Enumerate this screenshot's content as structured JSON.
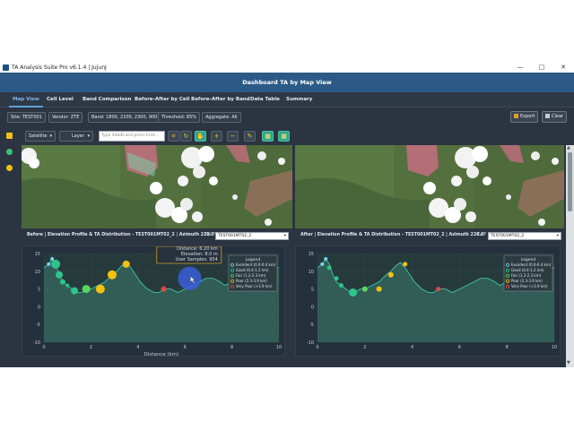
{
  "window": {
    "title": "TA Analysis Suite Pro v6.1.4 | JujunJ"
  },
  "banner": {
    "title": "Dashboard TA by Map View"
  },
  "tabs": [
    "Map View",
    "Cell Level",
    "Band Comparison",
    "Before-After by Cell",
    "Before-After by Band",
    "Data Table",
    "Summary"
  ],
  "filters": {
    "site": "Site: TEST001",
    "vendor": "Vendor: ZTE",
    "band": "Band: 1800, 2100, 2300, 900",
    "threshold": "Threshold: 85%",
    "aggregate": "Aggregate: All"
  },
  "actions": {
    "export": "Export",
    "clear": "Clear"
  },
  "toolbar": {
    "basemap": "Satellite",
    "layer": "Layer",
    "search_placeholder": "Type SiteID and press Ente..."
  },
  "before": {
    "title": "Before | Elevation Profile & TA Distribution - TEST001MT02_2 | Azimuth 220.0°",
    "cell_label": "Cell",
    "cell_value": "TEST001MT02_2"
  },
  "after": {
    "title": "After | Elevation Profile & TA Distribution - TEST001MT02_2 | Azimuth 220.0°",
    "cell_label": "Cell",
    "cell_value": "TEST001MT02_2"
  },
  "tooltip": {
    "line1": "Distance: 6.20 km",
    "line2": "Elevation: 8.0 m",
    "line3": "User Samples: 954"
  },
  "legend": {
    "title": "Legend",
    "items": [
      {
        "label": "Excellent (0.0-0.4 km)",
        "color": "#7ad3e8"
      },
      {
        "label": "Good (0.4-1.2 km)",
        "color": "#2ec48a"
      },
      {
        "label": "Fair (1.2-2.3 km)",
        "color": "#5ad65a"
      },
      {
        "label": "Poor (2.3-3.9 km)",
        "color": "#f2c20e"
      },
      {
        "label": "Very Poor (>3.9 km)",
        "color": "#e04848"
      }
    ]
  },
  "chart_data": [
    {
      "type": "line",
      "title": "",
      "xlabel": "Distance (km)",
      "ylabel": "",
      "xlim": [
        0,
        10
      ],
      "ylim": [
        -10,
        15
      ],
      "xticks": [
        0,
        2,
        4,
        6,
        8,
        10
      ],
      "yticks": [
        -10,
        -5,
        0,
        5,
        10,
        15
      ],
      "grid": true,
      "legend_position": "top-right",
      "profile": {
        "x": [
          0,
          0.2,
          0.35,
          0.5,
          0.65,
          0.8,
          1.0,
          1.2,
          1.4,
          1.6,
          1.8,
          2.0,
          2.3,
          2.6,
          2.9,
          3.1,
          3.3,
          3.5,
          3.7,
          3.9,
          4.1,
          4.4,
          4.7,
          4.9,
          5.1,
          5.4,
          5.7,
          6.0,
          6.3,
          6.6,
          6.9,
          7.2,
          7.5,
          7.7,
          8.0,
          8.3,
          8.6,
          9.0,
          9.3,
          9.6,
          10.0
        ],
        "y": [
          11,
          12,
          13.5,
          12,
          9,
          7,
          6,
          5,
          4,
          4,
          5,
          5,
          6,
          7,
          9,
          10,
          11.5,
          12.5,
          11,
          9,
          7,
          5,
          4,
          4,
          5,
          5,
          4,
          5,
          6,
          7,
          8,
          8,
          7,
          6,
          7,
          8,
          9,
          10,
          10,
          11,
          11
        ]
      },
      "samples": [
        {
          "x": 0.2,
          "y": 12,
          "size": 2,
          "color": "#7ad3e8"
        },
        {
          "x": 0.35,
          "y": 13.5,
          "size": 2,
          "color": "#7ad3e8"
        },
        {
          "x": 0.5,
          "y": 12,
          "size": 5,
          "color": "#2ec48a"
        },
        {
          "x": 0.65,
          "y": 9,
          "size": 4,
          "color": "#2ec48a"
        },
        {
          "x": 0.8,
          "y": 7,
          "size": 3,
          "color": "#2ec48a"
        },
        {
          "x": 1.0,
          "y": 6,
          "size": 2,
          "color": "#2ec48a"
        },
        {
          "x": 1.3,
          "y": 4.5,
          "size": 4,
          "color": "#2ec48a"
        },
        {
          "x": 1.8,
          "y": 5,
          "size": 4.5,
          "color": "#5ad65a"
        },
        {
          "x": 2.4,
          "y": 5,
          "size": 5,
          "color": "#f2c20e"
        },
        {
          "x": 2.9,
          "y": 9,
          "size": 5,
          "color": "#f2c20e"
        },
        {
          "x": 3.5,
          "y": 12,
          "size": 4,
          "color": "#f2c20e"
        },
        {
          "x": 5.1,
          "y": 5,
          "size": 3,
          "color": "#e04848"
        },
        {
          "x": 6.2,
          "y": 8,
          "size": 13,
          "color": "#3a5fd8"
        }
      ]
    },
    {
      "type": "line",
      "title": "",
      "xlabel": "",
      "ylabel": "",
      "xlim": [
        0,
        10
      ],
      "ylim": [
        -10,
        15
      ],
      "xticks": [
        0,
        2,
        4,
        6,
        8,
        10
      ],
      "yticks": [
        -10,
        -5,
        0,
        5,
        10,
        15
      ],
      "grid": true,
      "legend_position": "top-right",
      "profile": {
        "x": [
          0,
          0.2,
          0.35,
          0.5,
          0.65,
          0.8,
          1.0,
          1.2,
          1.4,
          1.6,
          1.8,
          2.0,
          2.3,
          2.6,
          2.9,
          3.1,
          3.3,
          3.5,
          3.7,
          3.9,
          4.1,
          4.4,
          4.7,
          4.9,
          5.1,
          5.4,
          5.7,
          6.0,
          6.3,
          6.6,
          6.9,
          7.2,
          7.5,
          7.7,
          8.0,
          8.3,
          8.6,
          9.0,
          9.3,
          9.6,
          10.0
        ],
        "y": [
          11,
          12,
          13.5,
          12,
          9,
          7,
          6,
          5,
          4,
          4,
          5,
          5,
          6,
          7,
          9,
          10,
          11.5,
          12.5,
          11,
          9,
          7,
          5,
          4,
          4,
          5,
          5,
          4,
          5,
          6,
          7,
          8,
          8,
          7,
          6,
          7,
          8,
          9,
          10,
          10,
          11,
          11
        ]
      },
      "samples": [
        {
          "x": 0.2,
          "y": 12,
          "size": 2,
          "color": "#7ad3e8"
        },
        {
          "x": 0.35,
          "y": 13.5,
          "size": 2,
          "color": "#7ad3e8"
        },
        {
          "x": 0.5,
          "y": 11,
          "size": 2.5,
          "color": "#2ec48a"
        },
        {
          "x": 0.8,
          "y": 8,
          "size": 2.5,
          "color": "#2ec48a"
        },
        {
          "x": 1.0,
          "y": 6,
          "size": 2.5,
          "color": "#2ec48a"
        },
        {
          "x": 1.5,
          "y": 4,
          "size": 4.5,
          "color": "#2ec48a"
        },
        {
          "x": 2.0,
          "y": 5,
          "size": 3,
          "color": "#5ad65a"
        },
        {
          "x": 2.6,
          "y": 5,
          "size": 3,
          "color": "#f2c20e"
        },
        {
          "x": 3.1,
          "y": 9,
          "size": 3,
          "color": "#f2c20e"
        },
        {
          "x": 3.7,
          "y": 12,
          "size": 2.5,
          "color": "#f2c20e"
        },
        {
          "x": 5.1,
          "y": 5,
          "size": 2.5,
          "color": "#e04848"
        }
      ]
    }
  ]
}
